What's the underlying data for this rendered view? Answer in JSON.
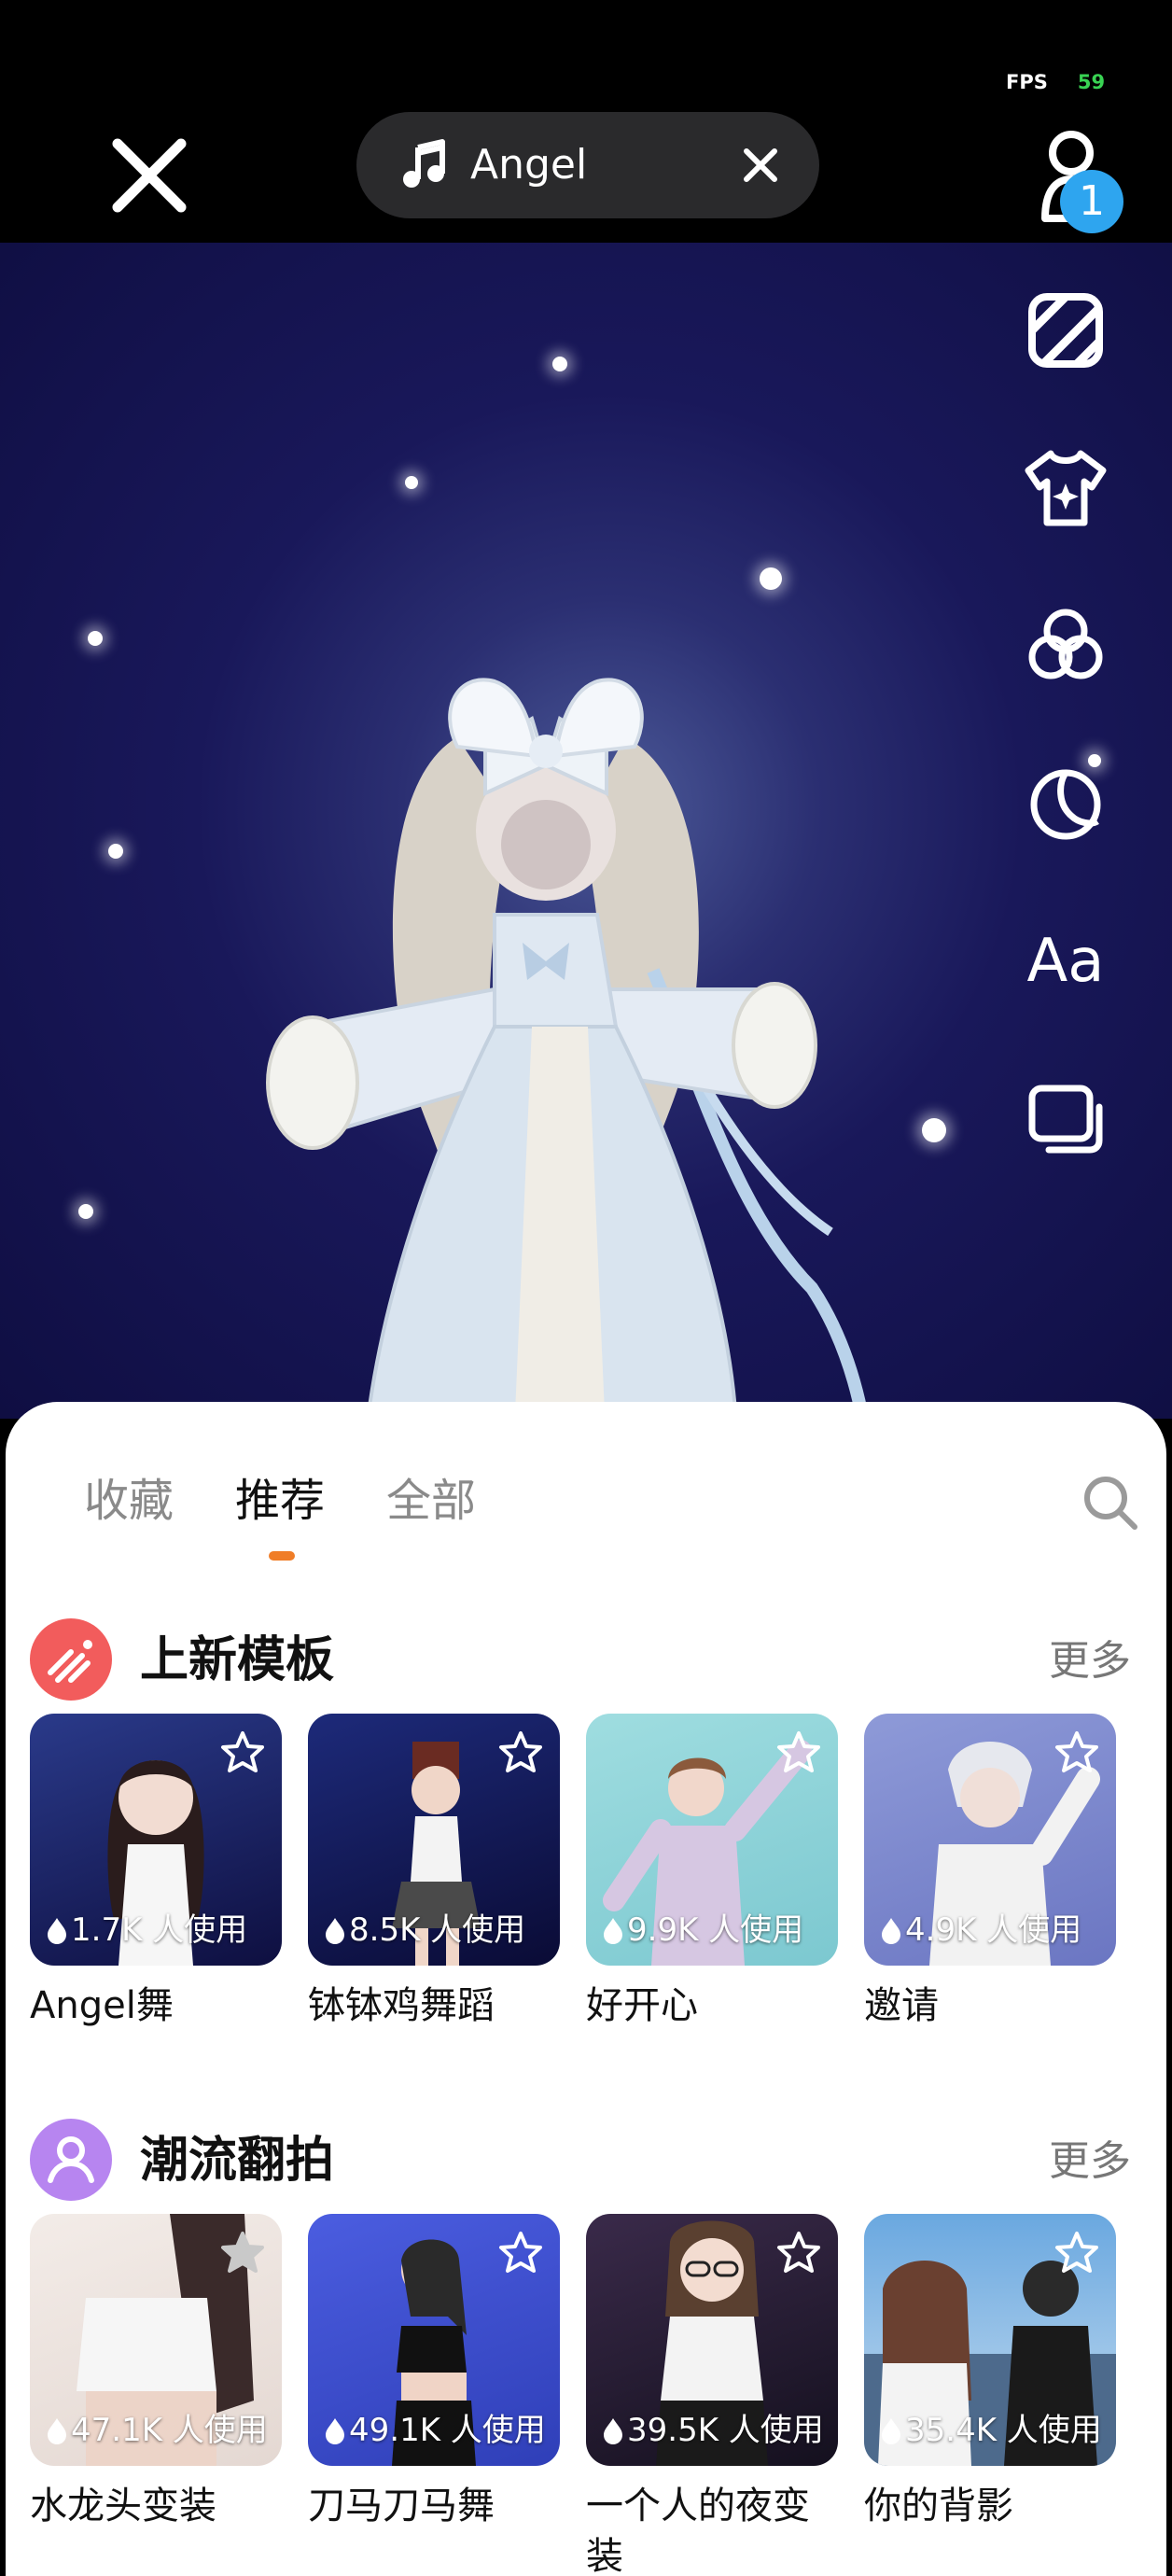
{
  "status": {
    "fps_label": "FPS",
    "fps_value": "59"
  },
  "music": {
    "title": "Angel",
    "icon": "music-note-icon",
    "clear_icon": "close-icon"
  },
  "top": {
    "close_icon": "close-icon",
    "user_icon": "user-icon",
    "badge_count": "1"
  },
  "toolbar": [
    "stripes-icon",
    "shirt-icon",
    "filter-circles-icon",
    "moon-icon",
    "text-icon",
    "layers-icon"
  ],
  "toolbar_text_label": "Aa",
  "sheet": {
    "tabs": [
      {
        "label": "收藏",
        "active": false
      },
      {
        "label": "推荐",
        "active": true
      },
      {
        "label": "全部",
        "active": false
      }
    ],
    "search_icon": "search-icon",
    "sections": [
      {
        "title": "上新模板",
        "more": "更多",
        "icon_color": "#f25c5c",
        "cards": [
          {
            "usage": "1.7K 人使用",
            "name": "Angel舞",
            "starred": false
          },
          {
            "usage": "8.5K 人使用",
            "name": "钵钵鸡舞蹈",
            "starred": false
          },
          {
            "usage": "9.9K 人使用",
            "name": "好开心",
            "starred": false
          },
          {
            "usage": "4.9K 人使用",
            "name": "邀请",
            "starred": false
          }
        ]
      },
      {
        "title": "潮流翻拍",
        "more": "更多",
        "icon_color": "#b785f0",
        "cards": [
          {
            "usage": "47.1K 人使用",
            "name": "水龙头变装",
            "starred": true
          },
          {
            "usage": "49.1K 人使用",
            "name": "刀马刀马舞",
            "starred": false
          },
          {
            "usage": "39.5K 人使用",
            "name": "一个人的夜变装",
            "starred": false
          },
          {
            "usage": "35.4K 人使用",
            "name": "你的背影",
            "starred": false
          }
        ]
      }
    ]
  },
  "colors": {
    "accent": "#f07d27",
    "badge": "#2ea5ef"
  }
}
